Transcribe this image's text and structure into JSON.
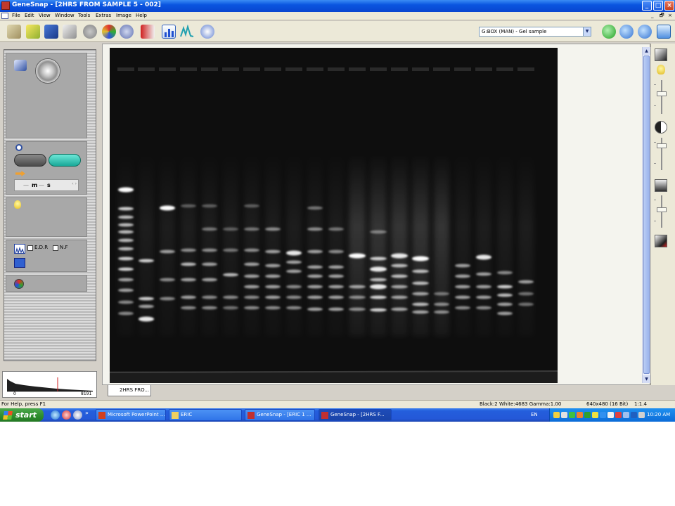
{
  "window": {
    "title": "GeneSnap - [2HRS FROM SAMPLE 5 - 002]",
    "minimize_label": "_",
    "maximize_label": "□",
    "close_label": "×"
  },
  "menu": {
    "items": [
      "File",
      "Edit",
      "View",
      "Window",
      "Tools",
      "Extras",
      "Image",
      "Help"
    ],
    "mdi_minimize": "_",
    "mdi_restore": "🗗",
    "mdi_close": "×"
  },
  "toolbar": {
    "icons": [
      "new-icon",
      "open-icon",
      "save-icon",
      "print-icon",
      "head-icon",
      "color-icon",
      "settings-icon",
      "book-icon",
      "histogram-icon",
      "peaks-icon",
      "help-icon"
    ],
    "capture_mode": "G:BOX (MAN) - Gel sample",
    "zoom_icons": [
      "zoom-in-icon",
      "zoom-out-icon",
      "zoom-actual-icon",
      "zoom-fit-icon"
    ]
  },
  "left_panel": {
    "exposure_minutes_label": "m",
    "exposure_seconds_label": "s",
    "exposure_dash": "—",
    "spin_glyph": "‹ ›",
    "edr_label": "E.D.R",
    "nf_label": "N.F",
    "histogram_min": "0",
    "histogram_max": "8191"
  },
  "document_tab": "2HRS FRO...",
  "status": {
    "help": "For Help, press F1",
    "levels": "Black:2 White:4683 Gamma:1.00",
    "resolution": "640x480 (16 Bit)",
    "zoom": "1:1.4"
  },
  "taskbar": {
    "start_label": "start",
    "tasks": [
      {
        "label": "Microsoft PowerPoint ...",
        "active": false
      },
      {
        "label": "ERIC",
        "active": false
      },
      {
        "label": "GeneSnap - [ERIC 1 ...",
        "active": false
      },
      {
        "label": "GeneSnap - [2HRS F...",
        "active": true
      }
    ],
    "language": "EN",
    "clock": "10:20 AM",
    "quick_launch_more": "»"
  },
  "colors": {
    "title_blue": "#0a55e0",
    "gel_background": "#0d0d0d",
    "band_white": "#ffffff",
    "live_pill": "#18a898",
    "taskbar_blue": "#245edc",
    "start_green": "#2c8c2c"
  }
}
